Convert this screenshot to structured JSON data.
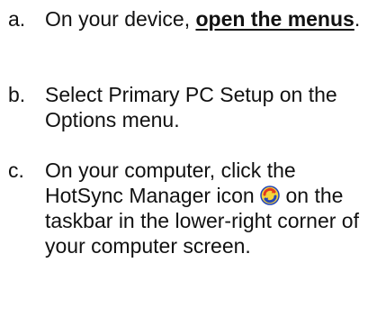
{
  "steps": [
    {
      "letter": "a.",
      "text_before": "On your device, ",
      "link": "open the menus",
      "text_after": "."
    },
    {
      "letter": "b.",
      "text": "Select Primary PC Setup on the Options menu."
    },
    {
      "letter": "c.",
      "text_before": "On your computer, click the HotSync Manager icon ",
      "icon": "hotsync-icon",
      "text_after": " on the taskbar in the lower-right corner of your computer screen."
    }
  ],
  "colors": {
    "text": "#111111",
    "icon_red": "#e23a1e",
    "icon_blue": "#2546b8",
    "icon_yellow": "#f4d33a"
  }
}
